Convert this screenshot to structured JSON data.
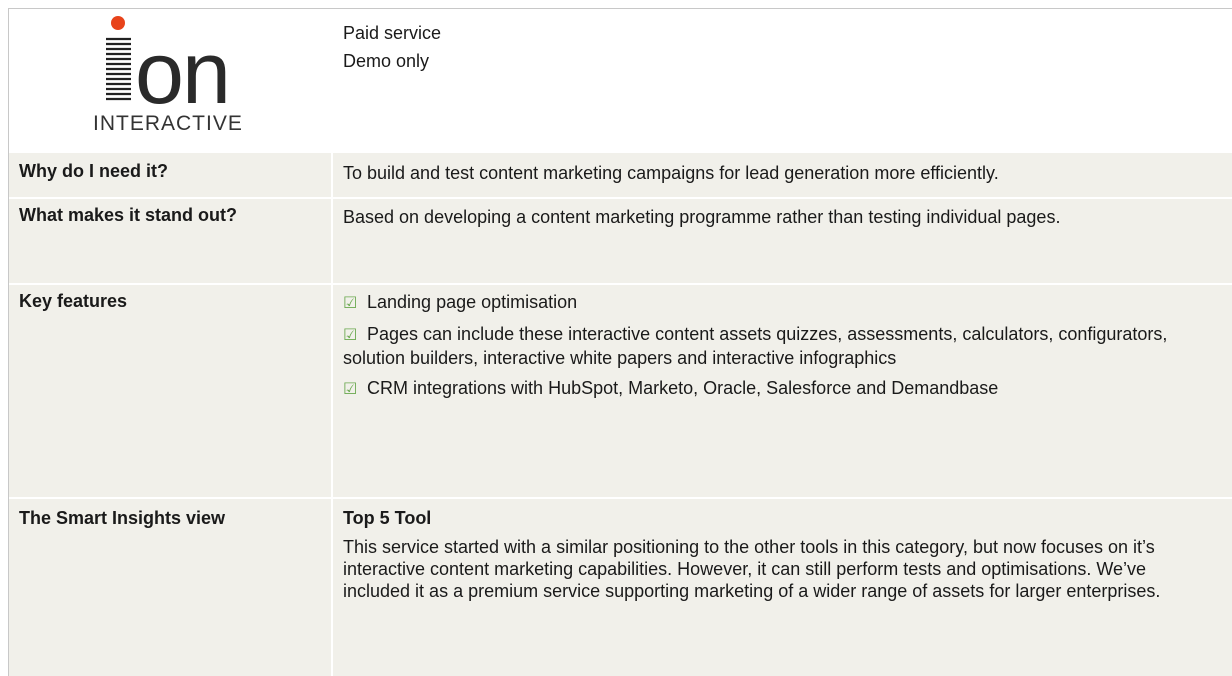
{
  "header": {
    "logo_text": "INTERACTIVE",
    "logo_brand": "on",
    "info_lines": [
      "Paid service",
      "Demo only"
    ]
  },
  "rows": [
    {
      "label": "Why do I need it?",
      "text": "To build and test content marketing campaigns for lead generation more efficiently."
    },
    {
      "label": "What makes it stand out?",
      "text": "Based on developing a content marketing programme rather than testing individual pages."
    },
    {
      "label": "Key features",
      "features": [
        "Landing page optimisation",
        "Pages can include these interactive content assets quizzes, assessments, calculators, configurators, solution builders, interactive white papers and interactive infographics",
        "CRM integrations with HubSpot, Marketo, Oracle, Salesforce and Demandbase"
      ]
    },
    {
      "label": "The Smart Insights view",
      "headline": "Top 5 Tool",
      "text": "This service started with a similar positioning to the other tools in this category, but now focuses on it’s interactive content marketing capabilities. However, it can still perform tests and optimisations. We’ve included it as a premium service supporting marketing of a wider range of assets for larger enterprises."
    }
  ],
  "colors": {
    "row_bg": "#f1f0ea",
    "check_green": "#6aa84f",
    "logo_orange": "#e8431a"
  },
  "icons": {
    "check": "checkbox-checked-icon"
  }
}
